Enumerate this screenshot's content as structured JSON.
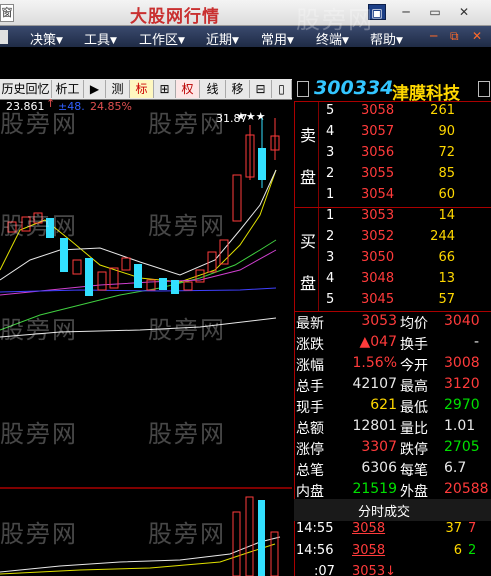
{
  "titlebar": {
    "app_icon": "窗",
    "title": "大股网行情"
  },
  "window_buttons": [
    "▣",
    "─",
    "▭",
    "✕"
  ],
  "menu": {
    "items": [
      {
        "label": "决策",
        "arrow": "▼"
      },
      {
        "label": "工具",
        "arrow": "▼"
      },
      {
        "label": "工作区",
        "arrow": "▼"
      },
      {
        "label": "近期",
        "arrow": "▼"
      },
      {
        "label": "常用",
        "arrow": "▼"
      },
      {
        "label": "终端",
        "arrow": "▼"
      },
      {
        "label": "帮助",
        "arrow": "▼"
      }
    ],
    "controls": [
      "─",
      "⧉",
      "✕"
    ]
  },
  "chart_toolbar": {
    "items": [
      "历史回忆",
      "析工",
      "▶",
      "测",
      "标",
      "⊞",
      "权",
      "线",
      "移",
      "⊟",
      "▯"
    ]
  },
  "chart": {
    "high_label": "23.861",
    "high_arrow": "↑",
    "pct_a": "±48.",
    "pct_b": "24.85%",
    "peak_label": "31.87",
    "stars": "★★★"
  },
  "stock": {
    "code": "300334",
    "name": "津膜科技"
  },
  "order_book": {
    "sell_label": [
      "卖",
      "盘"
    ],
    "buy_label": [
      "买",
      "盘"
    ],
    "sell": [
      {
        "level": "5",
        "price": "3058",
        "volume": "261"
      },
      {
        "level": "4",
        "price": "3057",
        "volume": "90"
      },
      {
        "level": "3",
        "price": "3056",
        "volume": "72"
      },
      {
        "level": "2",
        "price": "3055",
        "volume": "85"
      },
      {
        "level": "1",
        "price": "3054",
        "volume": "60"
      }
    ],
    "buy": [
      {
        "level": "1",
        "price": "3053",
        "volume": "14"
      },
      {
        "level": "2",
        "price": "3052",
        "volume": "244"
      },
      {
        "level": "3",
        "price": "3050",
        "volume": "66"
      },
      {
        "level": "4",
        "price": "3048",
        "volume": "13"
      },
      {
        "level": "5",
        "price": "3045",
        "volume": "57"
      }
    ]
  },
  "quote": [
    {
      "k1": "最新",
      "v1": "3053",
      "c1": "red",
      "k2": "均价",
      "v2": "3040",
      "c2": "red"
    },
    {
      "k1": "涨跌",
      "v1": "▲047",
      "c1": "red",
      "k2": "换手",
      "v2": "-",
      "c2": "wht"
    },
    {
      "k1": "涨幅",
      "v1": "1.56%",
      "c1": "red",
      "k2": "今开",
      "v2": "3008",
      "c2": "red"
    },
    {
      "k1": "总手",
      "v1": "42107",
      "c1": "wht",
      "k2": "最高",
      "v2": "3120",
      "c2": "red"
    },
    {
      "k1": "现手",
      "v1": "621",
      "c1": "yel",
      "k2": "最低",
      "v2": "2970",
      "c2": "green"
    },
    {
      "k1": "总额",
      "v1": "12801",
      "c1": "wht",
      "k2": "量比",
      "v2": "1.01",
      "c2": "wht"
    },
    {
      "k1": "涨停",
      "v1": "3307",
      "c1": "red",
      "k2": "跌停",
      "v2": "2705",
      "c2": "green"
    },
    {
      "k1": "总笔",
      "v1": "6306",
      "c1": "wht",
      "k2": "每笔",
      "v2": "6.7",
      "c2": "wht"
    },
    {
      "k1": "内盘",
      "v1": "21519",
      "c1": "green",
      "k2": "外盘",
      "v2": "20588",
      "c2": "red"
    }
  ],
  "trades": {
    "title": "分时成交",
    "rows": [
      {
        "time": "14:55",
        "price": "3058",
        "volume": "37",
        "dir": "7"
      },
      {
        "time": "14:56",
        "price": "3058",
        "volume": "6",
        "dir": "2"
      },
      {
        "time": ":07",
        "price": "3053↓",
        "volume": "",
        "dir": ""
      }
    ]
  },
  "watermark": "股旁网",
  "colors": {
    "up": "#ff3b3b",
    "down": "#00e000",
    "vol": "#ffd800",
    "code": "#33c5ff",
    "accent": "#a00000"
  }
}
